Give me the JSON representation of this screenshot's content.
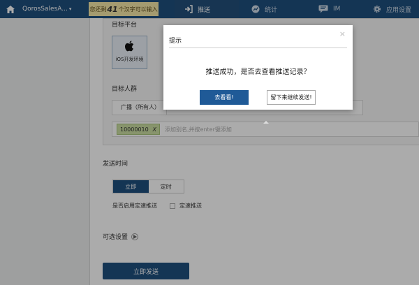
{
  "topnav": {
    "app_name": "QorosSalesA...",
    "quota_prefix": "您还剩",
    "quota_count": "41",
    "quota_suffix": "个汉字可以输入",
    "items": [
      {
        "label": "推送",
        "icon": "push-icon"
      },
      {
        "label": "统计",
        "icon": "stats-icon"
      },
      {
        "label": "IM",
        "icon": "chat-icon"
      },
      {
        "label": "应用设置",
        "icon": "gear-icon"
      }
    ]
  },
  "form": {
    "platform_title": "目标平台",
    "platform_ios": "iOS开发环境",
    "audience_title": "目标人群",
    "broadcast_label": "广播（所有人）",
    "tag_value": "10000010",
    "tag_remove": "X",
    "tag_placeholder": "添加别名,并按enter键添加",
    "send_time_title": "发送时间",
    "send_now": "立即",
    "send_scheduled": "定时",
    "rate_limit_question": "是否启用定速推送",
    "rate_limit_checkbox": "定速推送",
    "optional_settings": "可选设置",
    "send_button": "立即发送"
  },
  "modal": {
    "title": "提示",
    "close": "×",
    "message": "推送成功，是否去查看推送记录？",
    "confirm": "去看看!",
    "stay": "留下来继续发送!"
  },
  "colors": {
    "nav_bg": "#1f4f7e",
    "primary": "#1f5a97",
    "tag_bg": "#c9dda2",
    "quota_bg": "#f5e7a8"
  }
}
